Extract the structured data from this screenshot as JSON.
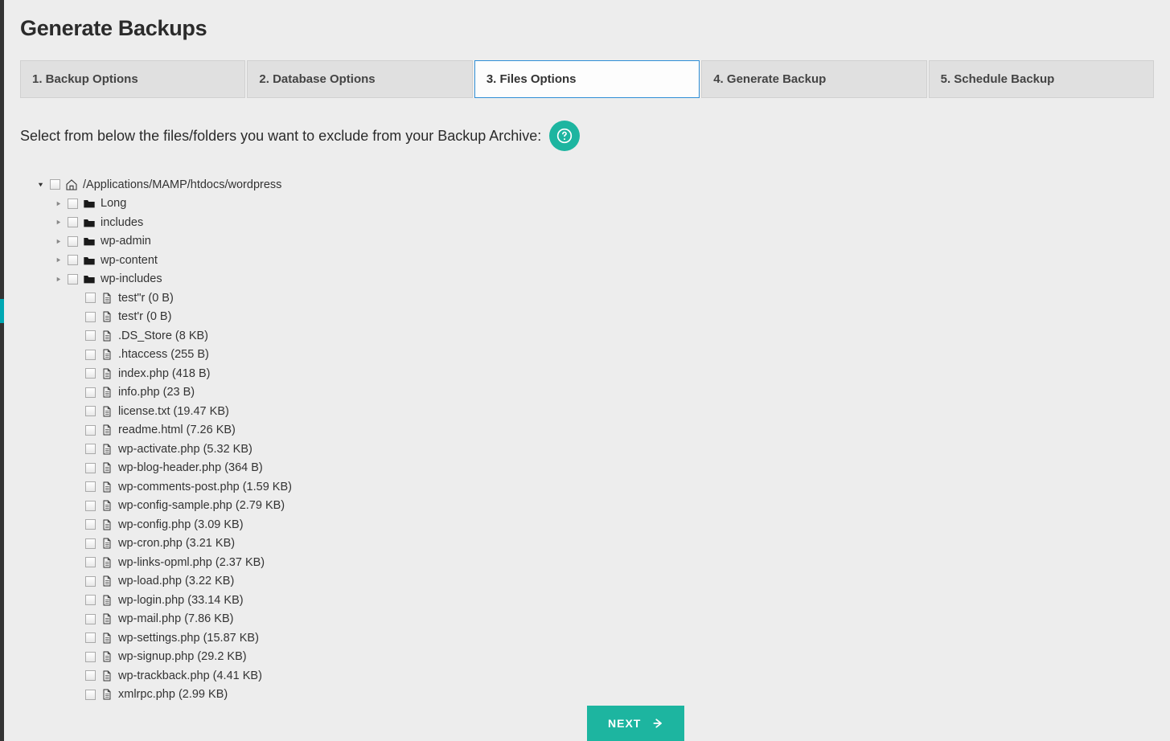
{
  "title": "Generate Backups",
  "tabs": [
    {
      "label": "1. Backup Options",
      "active": false
    },
    {
      "label": "2. Database Options",
      "active": false
    },
    {
      "label": "3. Files Options",
      "active": true
    },
    {
      "label": "4. Generate Backup",
      "active": false
    },
    {
      "label": "5. Schedule Backup",
      "active": false
    }
  ],
  "instruction": "Select from below the files/folders you want to exclude from your Backup Archive:",
  "tree": {
    "root": {
      "label": "/Applications/MAMP/htdocs/wordpress",
      "icon": "home",
      "expanded": true
    },
    "folders": [
      {
        "label": "Long"
      },
      {
        "label": "includes"
      },
      {
        "label": "wp-admin"
      },
      {
        "label": "wp-content"
      },
      {
        "label": "wp-includes"
      }
    ],
    "files": [
      {
        "label": "test\"r (0 B)"
      },
      {
        "label": "test'r (0 B)"
      },
      {
        "label": ".DS_Store (8 KB)"
      },
      {
        "label": ".htaccess (255 B)"
      },
      {
        "label": "index.php (418 B)"
      },
      {
        "label": "info.php (23 B)"
      },
      {
        "label": "license.txt (19.47 KB)"
      },
      {
        "label": "readme.html (7.26 KB)"
      },
      {
        "label": "wp-activate.php (5.32 KB)"
      },
      {
        "label": "wp-blog-header.php (364 B)"
      },
      {
        "label": "wp-comments-post.php (1.59 KB)"
      },
      {
        "label": "wp-config-sample.php (2.79 KB)"
      },
      {
        "label": "wp-config.php (3.09 KB)"
      },
      {
        "label": "wp-cron.php (3.21 KB)"
      },
      {
        "label": "wp-links-opml.php (2.37 KB)"
      },
      {
        "label": "wp-load.php (3.22 KB)"
      },
      {
        "label": "wp-login.php (33.14 KB)"
      },
      {
        "label": "wp-mail.php (7.86 KB)"
      },
      {
        "label": "wp-settings.php (15.87 KB)"
      },
      {
        "label": "wp-signup.php (29.2 KB)"
      },
      {
        "label": "wp-trackback.php (4.41 KB)"
      },
      {
        "label": "xmlrpc.php (2.99 KB)"
      }
    ]
  },
  "next_label": "NEXT"
}
